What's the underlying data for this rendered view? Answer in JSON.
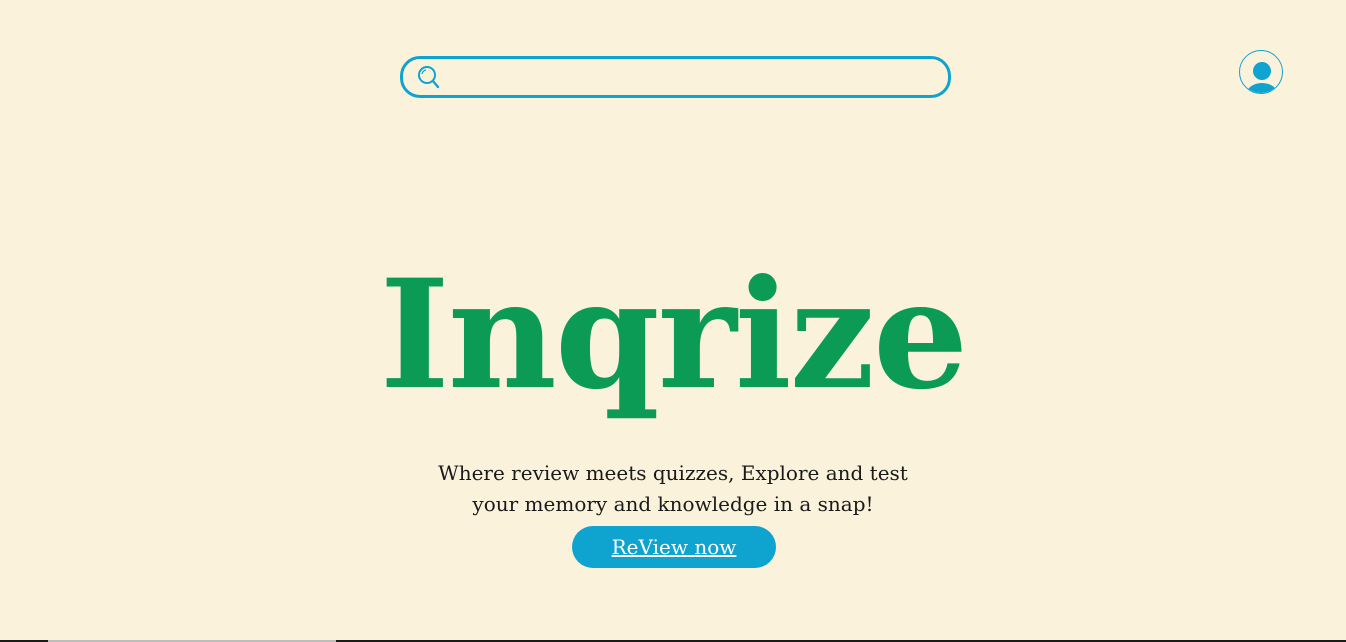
{
  "header": {
    "search": {
      "placeholder": "",
      "value": "",
      "icon": "search-icon"
    },
    "avatar_icon": "user-avatar-icon"
  },
  "hero": {
    "brand": "Inqrize",
    "tagline_line1": "Where review meets quizzes, Explore and test",
    "tagline_line2": "your memory and knowledge in a snap!",
    "cta_label": "ReView now"
  },
  "colors": {
    "background": "#fbf2dc",
    "accent": "#0fa3cf",
    "brand": "#0b9b55"
  }
}
